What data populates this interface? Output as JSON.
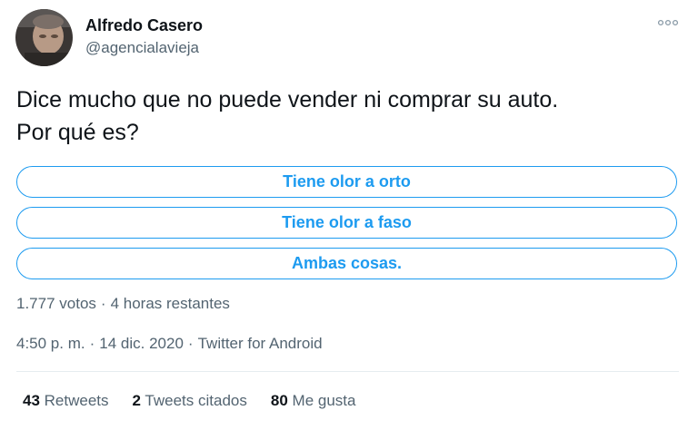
{
  "author": {
    "name": "Alfredo Casero",
    "handle": "@agencialavieja"
  },
  "tweet": {
    "lines": [
      "Dice mucho que no puede vender ni comprar su auto.",
      "Por qué es?"
    ]
  },
  "poll": {
    "options": [
      "Tiene olor a orto",
      "Tiene olor a faso",
      "Ambas cosas."
    ],
    "votes": "1.777 votos",
    "separator": "·",
    "time_left": "4 horas restantes",
    "accent_color": "#1d9bf0"
  },
  "meta": {
    "time": "4:50 p. m.",
    "date": "14 dic. 2020",
    "separator": "·",
    "source": "Twitter for Android"
  },
  "stats": {
    "retweets_count": "43",
    "retweets_label": "Retweets",
    "quotes_count": "2",
    "quotes_label": "Tweets citados",
    "likes_count": "80",
    "likes_label": "Me gusta"
  },
  "icons": {
    "more": "more-horizontal-icon",
    "avatar": "profile-photo"
  }
}
